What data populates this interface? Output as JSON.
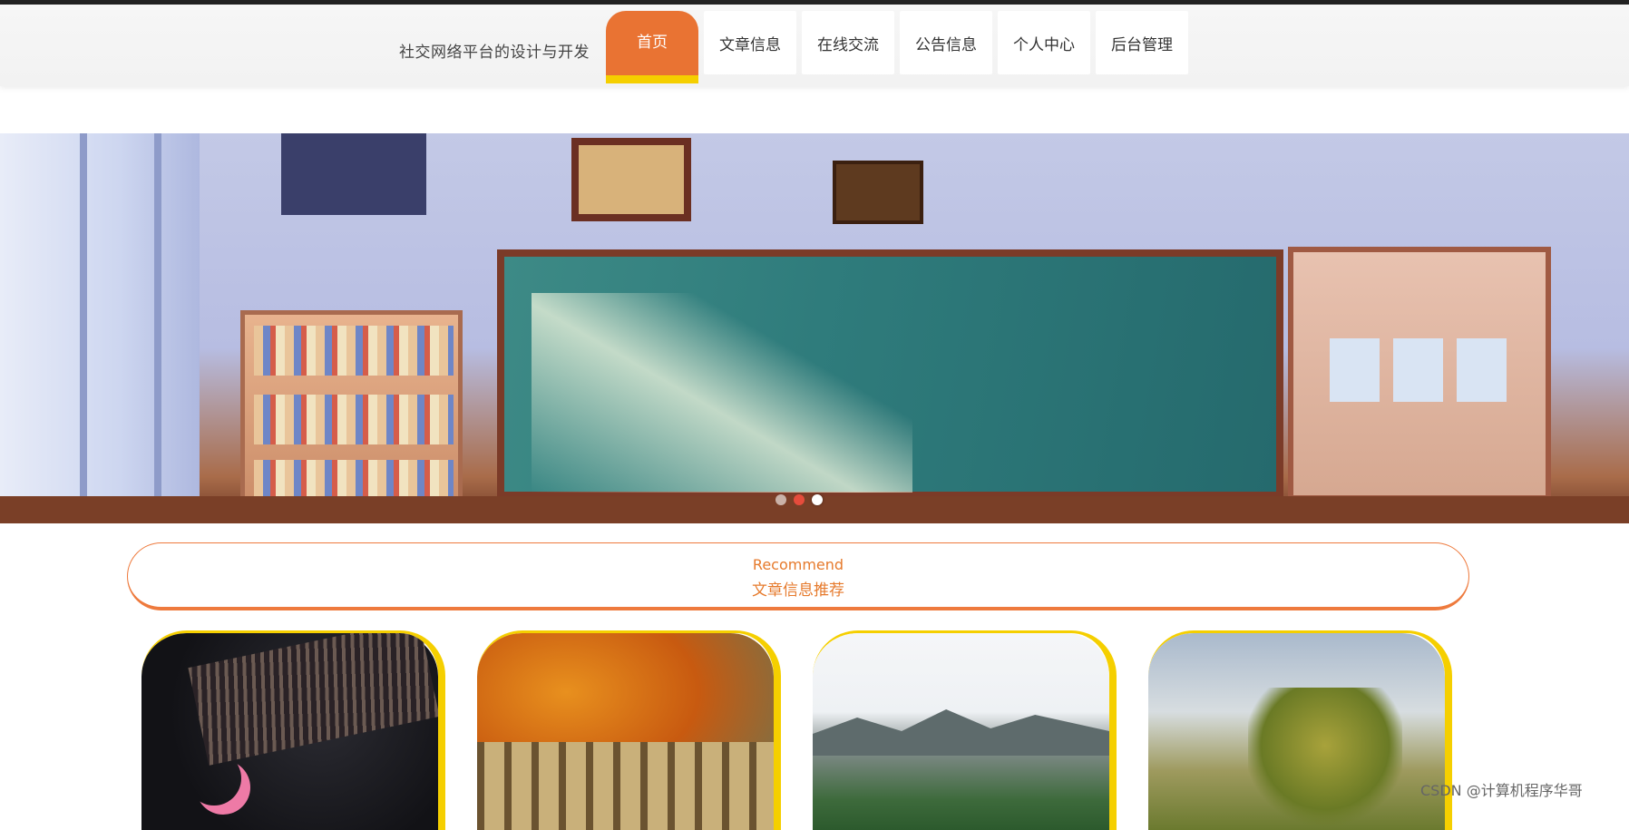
{
  "header": {
    "site_title": "社交网络平台的设计与开发",
    "nav": [
      {
        "label": "首页",
        "active": true
      },
      {
        "label": "文章信息",
        "active": false
      },
      {
        "label": "在线交流",
        "active": false
      },
      {
        "label": "公告信息",
        "active": false
      },
      {
        "label": "个人中心",
        "active": false
      },
      {
        "label": "后台管理",
        "active": false
      }
    ]
  },
  "banner": {
    "slides": 3,
    "active_slide": 3,
    "description": "classroom-illustration"
  },
  "recommend": {
    "title_en": "Recommend",
    "title_zh": "文章信息推荐"
  },
  "cards": [
    {
      "image": "night-sky-illustration"
    },
    {
      "image": "autumn-forest-photo"
    },
    {
      "image": "mountain-trees-photo"
    },
    {
      "image": "trees-landscape-painting"
    }
  ],
  "watermark": "CSDN @计算机程序华哥",
  "colors": {
    "accent": "#e97333",
    "highlight": "#f5cf00",
    "recommend": "#e67a2c"
  }
}
